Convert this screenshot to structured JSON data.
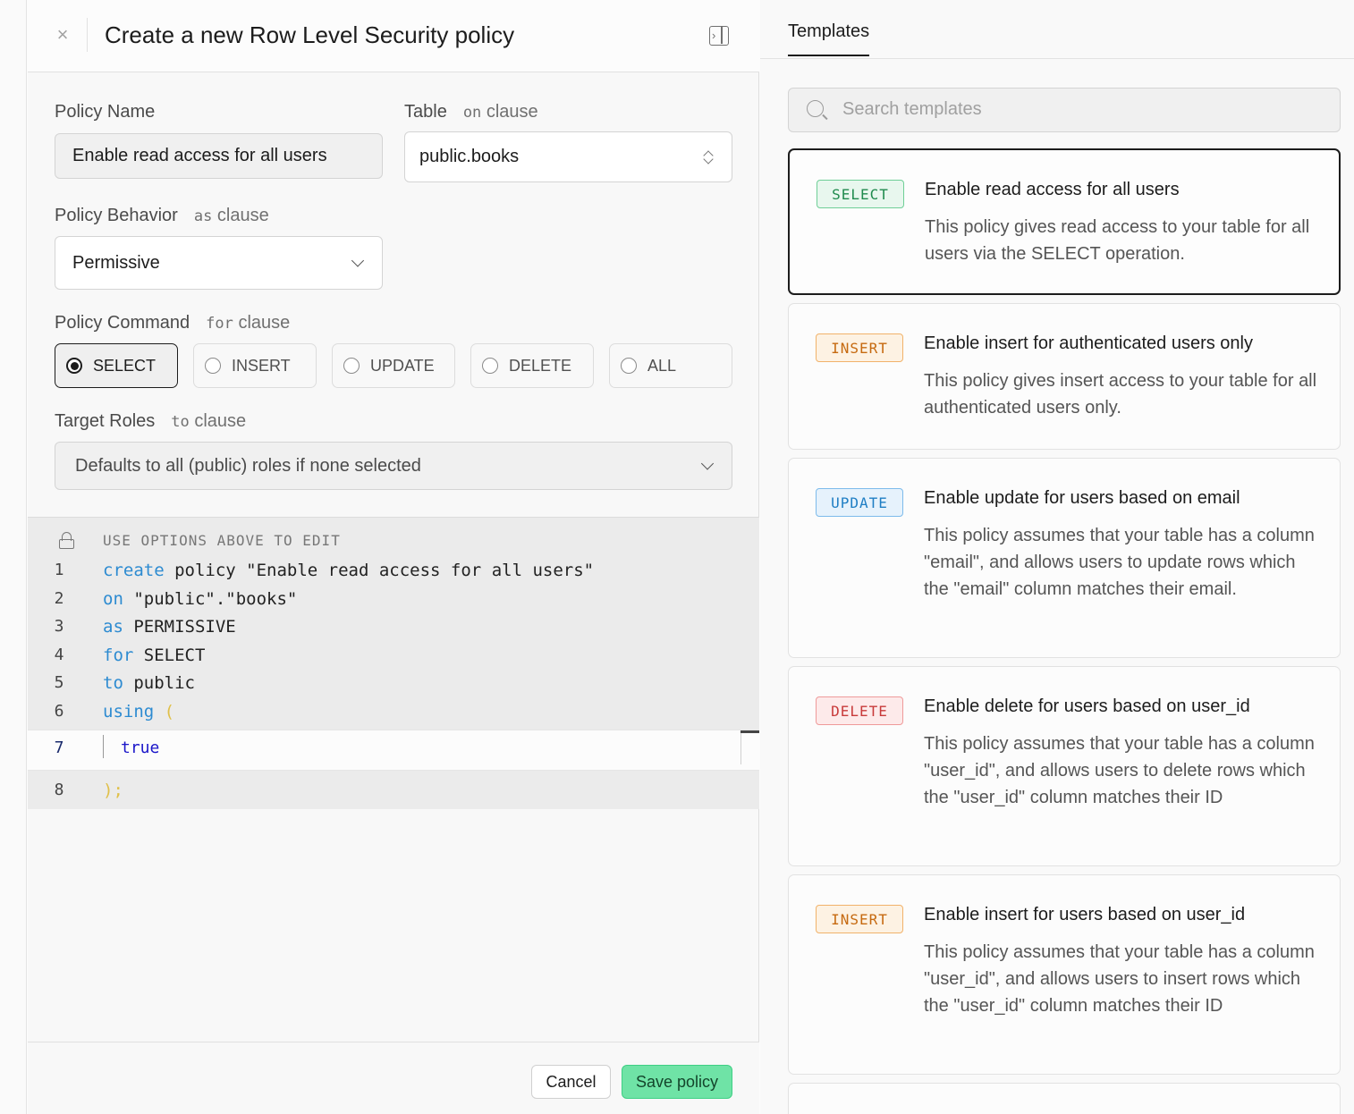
{
  "header": {
    "close_icon": "close-icon",
    "title": "Create a new Row Level Security policy",
    "toggle_icon": "panel-toggle-icon"
  },
  "form": {
    "policy_name": {
      "label": "Policy Name",
      "value": "Enable read access for all users"
    },
    "table": {
      "label": "Table",
      "keyword": "on",
      "suffix": "clause",
      "value": "public.books"
    },
    "behavior": {
      "label": "Policy Behavior",
      "keyword": "as",
      "suffix": "clause",
      "value": "Permissive"
    },
    "command": {
      "label": "Policy Command",
      "keyword": "for",
      "suffix": "clause",
      "options": [
        "SELECT",
        "INSERT",
        "UPDATE",
        "DELETE",
        "ALL"
      ],
      "selected": "SELECT"
    },
    "roles": {
      "label": "Target Roles",
      "keyword": "to",
      "suffix": "clause",
      "placeholder": "Defaults to all (public) roles if none selected"
    }
  },
  "editor": {
    "hint": "USE OPTIONS ABOVE TO EDIT",
    "lines": [
      {
        "n": "1",
        "kw": "create",
        "rest": " policy \"Enable read access for all users\""
      },
      {
        "n": "2",
        "kw": "on",
        "rest": " \"public\".\"books\""
      },
      {
        "n": "3",
        "kw": "as",
        "rest": " PERMISSIVE"
      },
      {
        "n": "4",
        "kw": "for",
        "rest": " SELECT"
      },
      {
        "n": "5",
        "kw": "to",
        "rest": " public"
      },
      {
        "n": "6",
        "kw": "using",
        "rest": " ("
      },
      {
        "n": "7",
        "kw": "",
        "rest": "true"
      },
      {
        "n": "8",
        "kw": "",
        "rest": ");"
      }
    ]
  },
  "footer": {
    "cancel": "Cancel",
    "save": "Save policy"
  },
  "templates": {
    "tab": "Templates",
    "search_placeholder": "Search templates",
    "cards": [
      {
        "badge": "SELECT",
        "title": "Enable read access for all users",
        "desc": "This policy gives read access to your table for all users via the SELECT operation."
      },
      {
        "badge": "INSERT",
        "title": "Enable insert for authenticated users only",
        "desc": "This policy gives insert access to your table for all authenticated users only."
      },
      {
        "badge": "UPDATE",
        "title": "Enable update for users based on email",
        "desc": "This policy assumes that your table has a column \"email\", and allows users to update rows which the \"email\" column matches their email."
      },
      {
        "badge": "DELETE",
        "title": "Enable delete for users based on user_id",
        "desc": "This policy assumes that your table has a column \"user_id\", and allows users to delete rows which the \"user_id\" column matches their ID"
      },
      {
        "badge": "INSERT",
        "title": "Enable insert for users based on user_id",
        "desc": "This policy assumes that your table has a column \"user_id\", and allows users to insert rows which the \"user_id\" column matches their ID"
      }
    ]
  },
  "colors": {
    "save_button": "#6fe3a6",
    "keyword": "#2d8bd1",
    "select_badge": "#1f8a4d",
    "insert_badge": "#c66a10",
    "update_badge": "#1f7ec4",
    "delete_badge": "#c83a3a"
  }
}
